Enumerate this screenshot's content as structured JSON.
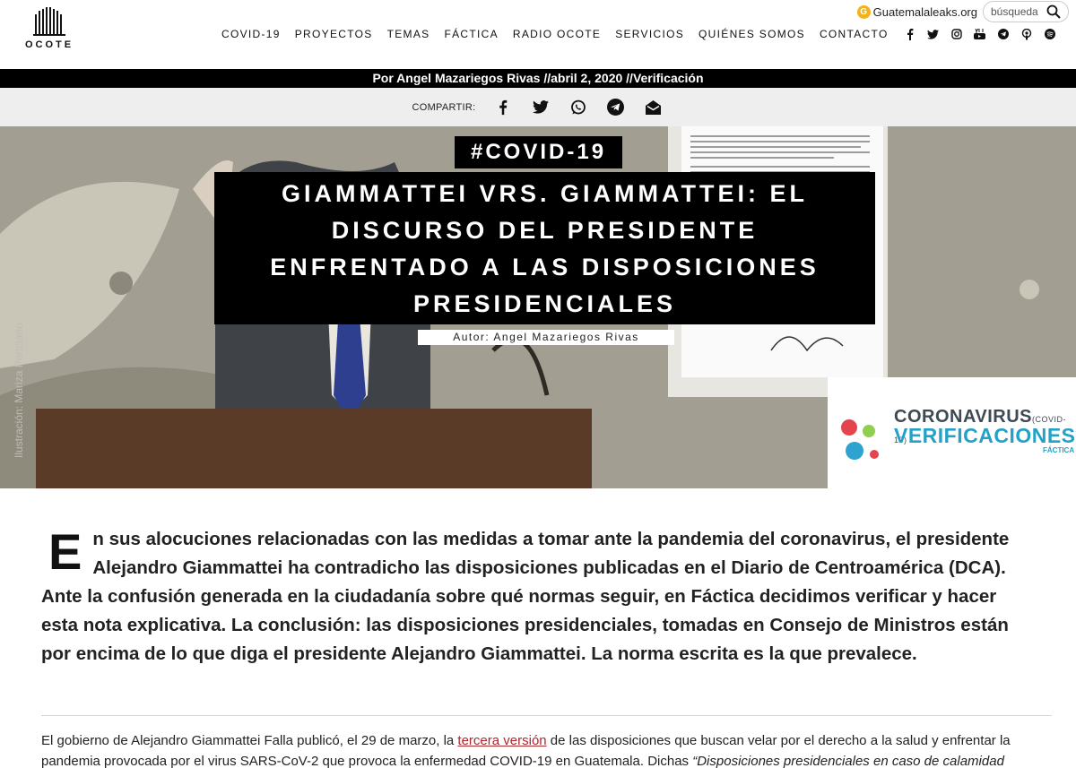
{
  "header": {
    "logo_text": "OCOTE",
    "gleaks": "Guatemalaleaks.org",
    "search_placeholder": "búsqueda",
    "nav": [
      "COVID-19",
      "PROYECTOS",
      "TEMAS",
      "FÁCTICA",
      "RADIO OCOTE",
      "SERVICIOS",
      "QUIÉNES SOMOS",
      "CONTACTO"
    ],
    "social_icons": [
      "facebook-icon",
      "twitter-icon",
      "instagram-icon",
      "youtube-icon",
      "telegram-icon",
      "podcast-icon",
      "spotify-icon"
    ]
  },
  "byline": "Por Angel Mazariegos Rivas //abril 2, 2020 //Verificación",
  "share": {
    "label": "COMPARTIR:",
    "icons": [
      "facebook-icon",
      "twitter-icon",
      "whatsapp-icon",
      "telegram-icon",
      "email-icon"
    ]
  },
  "hero": {
    "tag": "#COVID-19",
    "title": "GIAMMATTEI VRS. GIAMMATTEI: EL DISCURSO DEL PRESIDENTE ENFRENTADO A LAS DISPOSICIONES PRESIDENCIALES",
    "title_lines": [
      "GIAMMATTEI VRS. GIAMMATTEI: EL",
      "DISCURSO DEL PRESIDENTE",
      "ENFRENTADO A LAS DISPOSICIONES",
      "PRESIDENCIALES"
    ],
    "author": "Autor: Angel Mazariegos Rivas",
    "credit": "Ilustración: Mariza Ponciano",
    "badge_line1": "CORONAVIRUS",
    "badge_line1_small": "(COVID-19)",
    "badge_line2": "VERIFICACIONES",
    "badge_line3": "FÁCTICA"
  },
  "article": {
    "lead_dropcap": "E",
    "lead_text": "n sus alocuciones relacionadas con las medidas a tomar ante la pandemia del coronavirus, el presidente Alejandro Giammattei ha contradicho las disposiciones publicadas en el Diario de Centroamérica (DCA). Ante la confusión generada en la ciudadanía sobre qué normas seguir, en Fáctica decidimos verificar y hacer esta nota explicativa. La conclusión: las disposiciones presidenciales, tomadas en Consejo de Ministros están por encima de lo que diga el presidente Alejandro Giammattei. La norma escrita es la que prevalece.",
    "body_before_link": "El gobierno de Alejandro Giammattei Falla publicó, el 29 de marzo,  la ",
    "body_link": "tercera versión",
    "body_after_link": " de las disposiciones que buscan velar por el derecho a la salud y enfrentar la pandemia provocada por el virus SARS-CoV-2 que provoca la enfermedad  COVID-19 en Guatemala. Dichas ",
    "body_italic": "“Disposiciones presidenciales en caso de calamidad"
  }
}
